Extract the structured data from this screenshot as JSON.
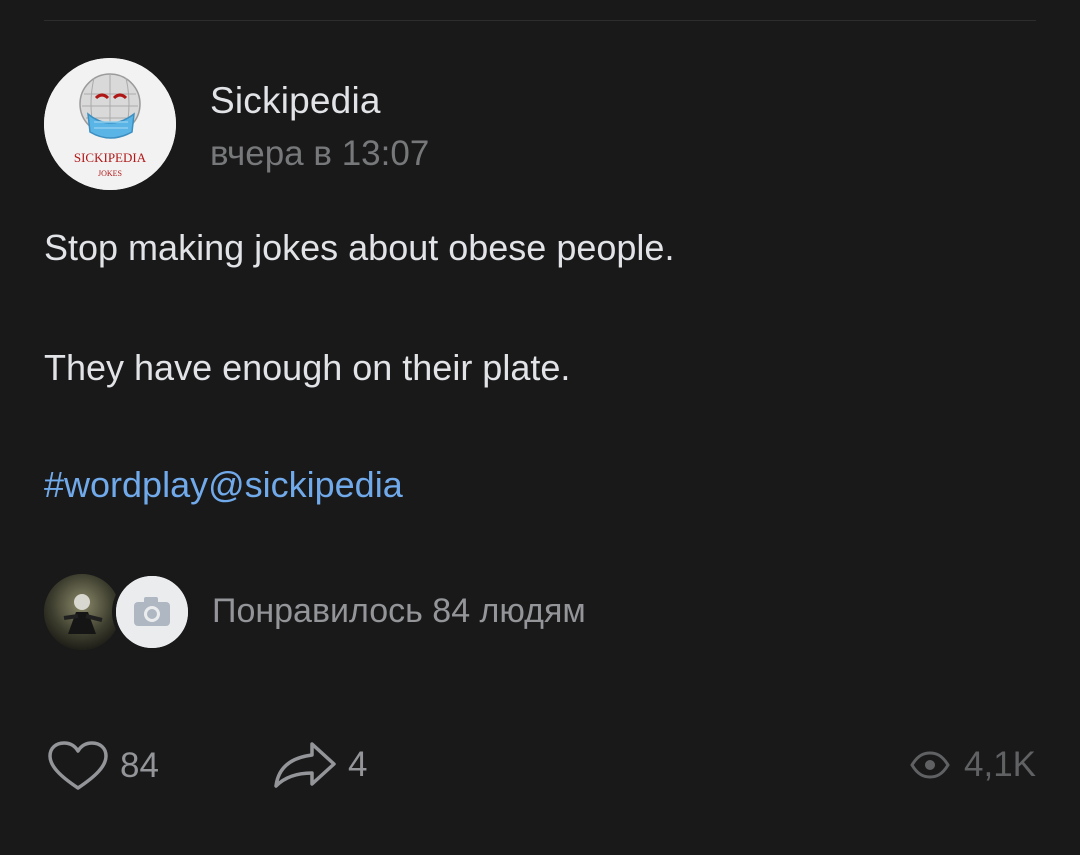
{
  "author": {
    "name": "Sickipedia",
    "time": "вчера в 13:07",
    "avatar_caption": "SICKIPEDIA",
    "avatar_subcaption": "JOKES"
  },
  "post": {
    "line1": "Stop making jokes about obese people.",
    "line2": "They have enough on their plate.",
    "hashtag": "#wordplay@sickipedia"
  },
  "likers": {
    "summary": "Понравилось 84 людям"
  },
  "actions": {
    "likes": "84",
    "shares": "4",
    "views": "4,1K"
  },
  "colors": {
    "background": "#19191a",
    "text": "#e1e3e6",
    "secondary": "#76787a",
    "link": "#71aaeb"
  }
}
